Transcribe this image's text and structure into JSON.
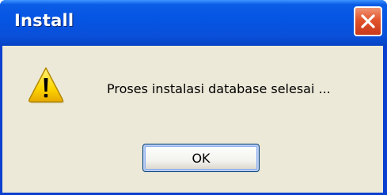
{
  "window": {
    "title": "Install"
  },
  "dialog": {
    "icon": "warning-icon",
    "message": "Proses instalasi database selesai ...",
    "ok_label": "OK"
  },
  "colors": {
    "titlebar": "#0554e3",
    "client_background": "#ece9d8",
    "close_button": "#e2542c",
    "warning_yellow": "#ffd700"
  }
}
